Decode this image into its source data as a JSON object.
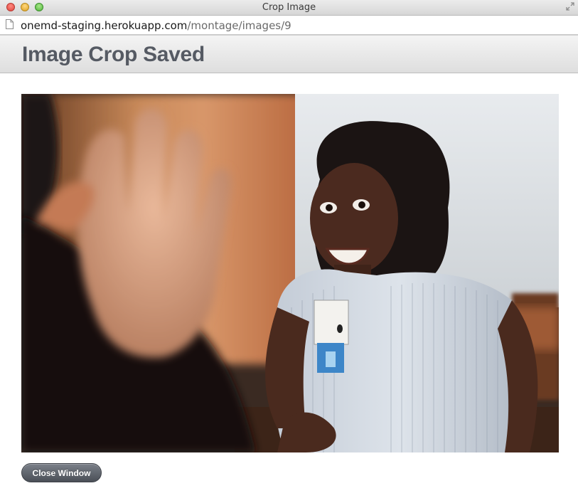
{
  "window": {
    "title": "Crop Image"
  },
  "address_bar": {
    "host": "onemd-staging.herokuapp.com",
    "path": "/montage/images/9"
  },
  "header": {
    "title": "Image Crop Saved"
  },
  "main": {
    "image_subject": "smiling woman with name badge at table, hand raised in foreground",
    "close_button_label": "Close Window"
  },
  "colors": {
    "header_text": "#555a63",
    "button_bg": "#5f646c",
    "button_text": "#ffffff"
  },
  "icons": {
    "page": "page-icon",
    "fullscreen": "fullscreen-icon"
  }
}
